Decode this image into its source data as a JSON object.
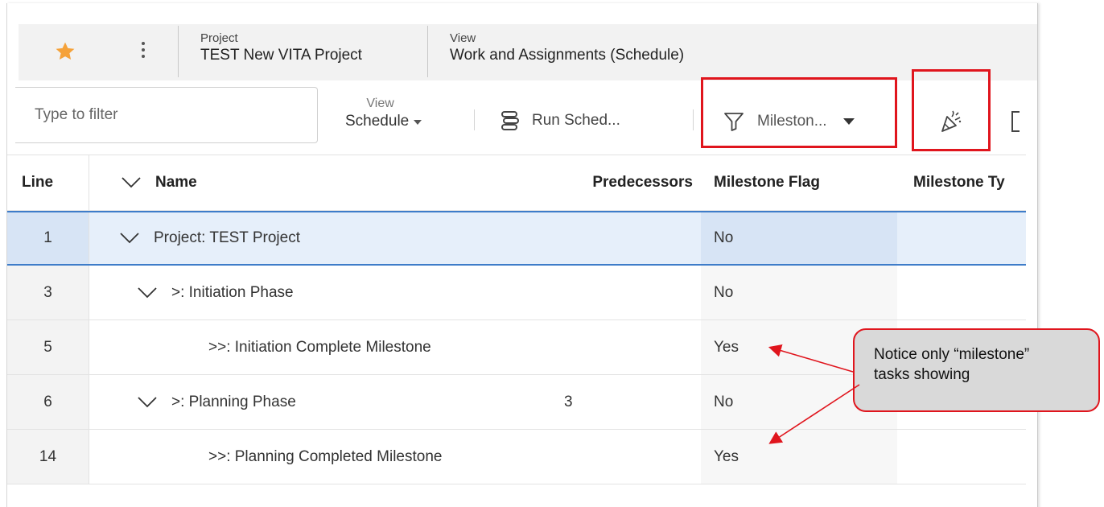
{
  "header": {
    "project_label": "Project",
    "project_name": "TEST New VITA Project",
    "view_label": "View",
    "view_name": "Work and Assignments (Schedule)"
  },
  "toolbar": {
    "filter_placeholder": "Type to filter",
    "view_label": "View",
    "view_value": "Schedule",
    "run_schedule_label": "Run Sched...",
    "filter_value": "Mileston..."
  },
  "grid": {
    "columns": {
      "line": "Line",
      "name": "Name",
      "predecessors": "Predecessors",
      "milestone_flag": "Milestone Flag",
      "milestone_type": "Milestone Ty"
    },
    "rows": [
      {
        "line": "1",
        "name": "Project: TEST Project",
        "predecessors": "",
        "milestone_flag": "No",
        "milestone_type": ""
      },
      {
        "line": "3",
        "name": ">: Initiation Phase",
        "predecessors": "",
        "milestone_flag": "No",
        "milestone_type": ""
      },
      {
        "line": "5",
        "name": ">>: Initiation Complete Milestone",
        "predecessors": "",
        "milestone_flag": "Yes",
        "milestone_type": ""
      },
      {
        "line": "6",
        "name": ">: Planning Phase",
        "predecessors": "3",
        "milestone_flag": "No",
        "milestone_type": ""
      },
      {
        "line": "14",
        "name": ">>: Planning Completed Milestone",
        "predecessors": "",
        "milestone_flag": "Yes",
        "milestone_type": ""
      }
    ]
  },
  "callout": {
    "line1": "Notice only “milestone”",
    "line2": "tasks showing"
  },
  "icons": {
    "favorite": "star-icon",
    "more": "more-vertical-icon",
    "run_schedule": "run-schedule-icon",
    "filter": "filter-icon",
    "highlight": "party-popper-icon",
    "expand": "chevron-down-icon"
  },
  "colors": {
    "star": "#f5a23a",
    "highlight_border": "#e0151d",
    "selected_row": "#e6effa",
    "selected_border": "#3e7cc9",
    "callout_fill": "#d9d9d9"
  }
}
